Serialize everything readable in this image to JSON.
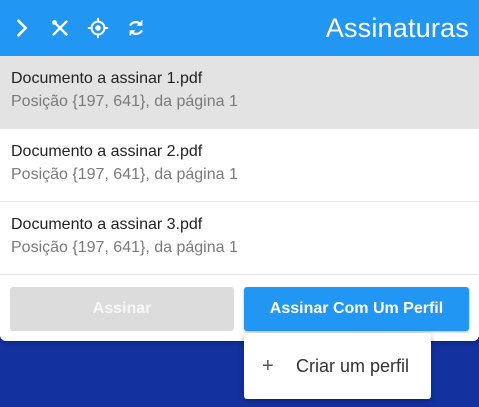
{
  "toolbar": {
    "title": "Assinaturas",
    "icons": [
      "chevron-right-icon",
      "crossed-tools-icon",
      "gps-target-icon",
      "refresh-icon"
    ],
    "accent_color": "#2196f3"
  },
  "documents": [
    {
      "name": "Documento a assinar 1.pdf",
      "position": "Posição {197, 641}, da página 1",
      "selected": true
    },
    {
      "name": "Documento a assinar 2.pdf",
      "position": "Posição {197, 641}, da página 1",
      "selected": false
    },
    {
      "name": "Documento a assinar 3.pdf",
      "position": "Posição {197, 641}, da página 1",
      "selected": false
    }
  ],
  "actions": {
    "sign_label": "Assinar",
    "sign_with_profile_label": "Assinar Com Um Perfil"
  },
  "menu": {
    "items": [
      {
        "icon": "plus-icon",
        "glyph": "+",
        "label": "Criar um perfil"
      }
    ]
  }
}
